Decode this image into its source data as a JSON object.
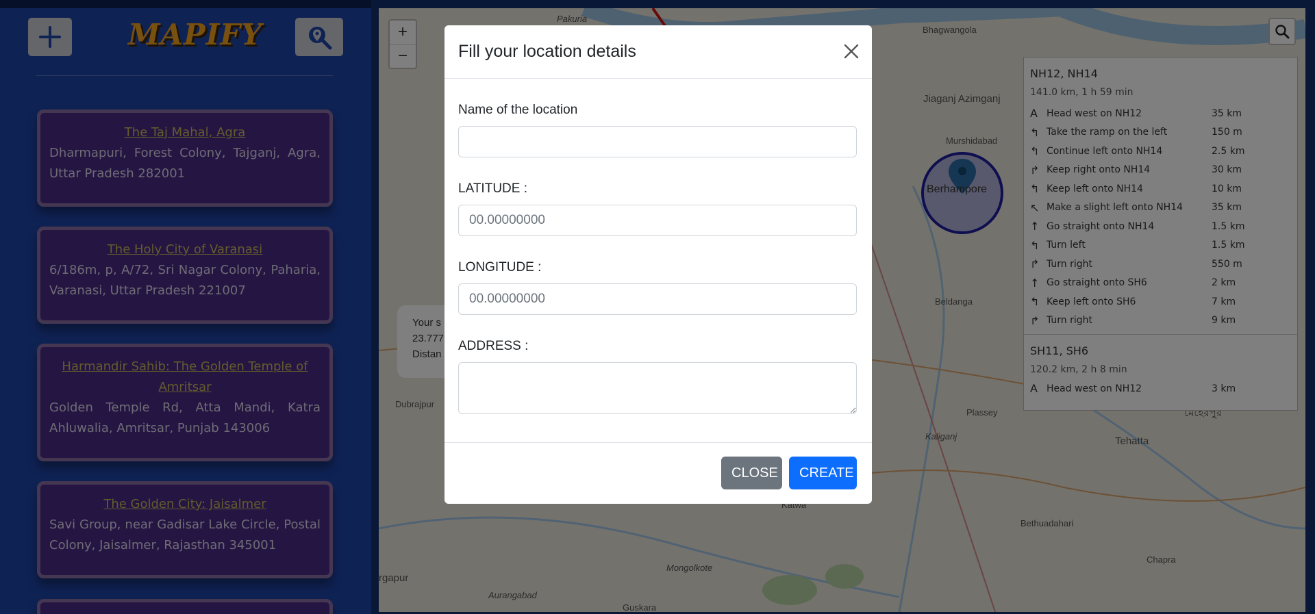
{
  "app": {
    "logo": "MAPIFY"
  },
  "sidebar": {
    "add_icon": "plus-icon",
    "search_icon": "map-search-icon",
    "cards": [
      {
        "title": "The Taj Mahal, Agra",
        "address": "Dharmapuri, Forest Colony, Tajganj, Agra, Uttar Pradesh 282001"
      },
      {
        "title": "The Holy City of Varanasi",
        "address": "6/186m, p, A/72, Sri Nagar Colony, Paharia, Varanasi, Uttar Pradesh 221007"
      },
      {
        "title": "Harmandir Sahib: The Golden Temple of Amritsar",
        "address": "Golden Temple Rd, Atta Mandi, Katra Ahluwalia, Amritsar, Punjab 143006"
      },
      {
        "title": "The Golden City: Jaisalmer",
        "address": "Savi Group, near Gadisar Lake Circle, Postal Colony, Jaisalmer, Rajasthan 345001"
      }
    ]
  },
  "map": {
    "zoom_in": "+",
    "zoom_out": "−",
    "popup_lines": [
      "Your s",
      "23.777",
      "Distan"
    ],
    "place_labels": [
      "Bhagwangola",
      "Jiaganj Azimganj",
      "Murshidabad",
      "Berhampore",
      "Beldanga",
      "Plassey",
      "Tehatta",
      "Dubrajpur",
      "Katwa",
      "Bethuadahari",
      "Chapra",
      "Guskara",
      "Mongolkote",
      "Kaliganj",
      "Pakuria",
      "Aurangabad",
      "মেহেরপুর",
      "rgapur"
    ]
  },
  "routing": {
    "route1": {
      "name": "NH12, NH14",
      "summary": "141.0 km, 1 h 59 min",
      "steps": [
        {
          "icon": "A",
          "text": "Head west on NH12",
          "dist": "35 km"
        },
        {
          "icon": "↰",
          "text": "Take the ramp on the left",
          "dist": "150 m"
        },
        {
          "icon": "↰",
          "text": "Continue left onto NH14",
          "dist": "2.5 km"
        },
        {
          "icon": "↱",
          "text": "Keep right onto NH14",
          "dist": "30 km"
        },
        {
          "icon": "↰",
          "text": "Keep left onto NH14",
          "dist": "10 km"
        },
        {
          "icon": "↖",
          "text": "Make a slight left onto NH14",
          "dist": "35 km"
        },
        {
          "icon": "↑",
          "text": "Go straight onto NH14",
          "dist": "1.5 km"
        },
        {
          "icon": "↰",
          "text": "Turn left",
          "dist": "1.5 km"
        },
        {
          "icon": "↱",
          "text": "Turn right",
          "dist": "550 m"
        },
        {
          "icon": "↑",
          "text": "Go straight onto SH6",
          "dist": "2 km"
        },
        {
          "icon": "↰",
          "text": "Keep left onto SH6",
          "dist": "7 km"
        },
        {
          "icon": "↱",
          "text": "Turn right",
          "dist": "9 km"
        }
      ]
    },
    "route2": {
      "name": "SH11, SH6",
      "summary": "120.2 km, 2 h 8 min",
      "first_step": {
        "icon": "A",
        "text": "Head west on NH12",
        "dist": "3 km"
      }
    }
  },
  "modal": {
    "title": "Fill your location details",
    "close_icon": "close-icon",
    "name_label": "Name of the location",
    "name_value": "",
    "lat_label": "LATITUDE :",
    "lat_placeholder": "00.00000000",
    "lng_label": "LONGITUDE :",
    "lng_placeholder": "00.00000000",
    "address_label": "ADDRESS :",
    "address_value": "",
    "close_button": "CLOSE",
    "create_button": "CREATE"
  },
  "colors": {
    "sidebar": "#1e44a8",
    "card": "#4a2a87",
    "primary": "#0d6efd",
    "secondary": "#6c757d"
  }
}
